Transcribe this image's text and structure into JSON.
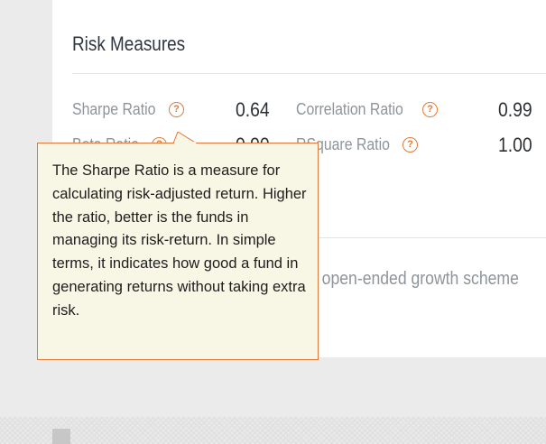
{
  "section": {
    "title": "Risk Measures"
  },
  "metrics": [
    {
      "label": "Sharpe Ratio",
      "value": "0.64"
    },
    {
      "label": "Beta Ratio",
      "value": "0.90"
    },
    {
      "label": "Correlation Ratio",
      "value": "0.99"
    },
    {
      "label": "RSquare Ratio",
      "value": "1.00"
    }
  ],
  "help_icon_glyph": "?",
  "scheme": {
    "text": "n open-ended growth scheme"
  },
  "tooltip": {
    "text": "The Sharpe Ratio is a measure for calculating risk-adjusted return. Higher the ratio, better is the funds in managing its risk-return. In simple terms, it indicates how good a fund in generating returns without taking extra risk."
  },
  "colors": {
    "accent": "#e07a3a",
    "tooltip_bg": "#f8f7e5",
    "label_gray": "#8d949a",
    "page_bg": "#ebebeb"
  }
}
